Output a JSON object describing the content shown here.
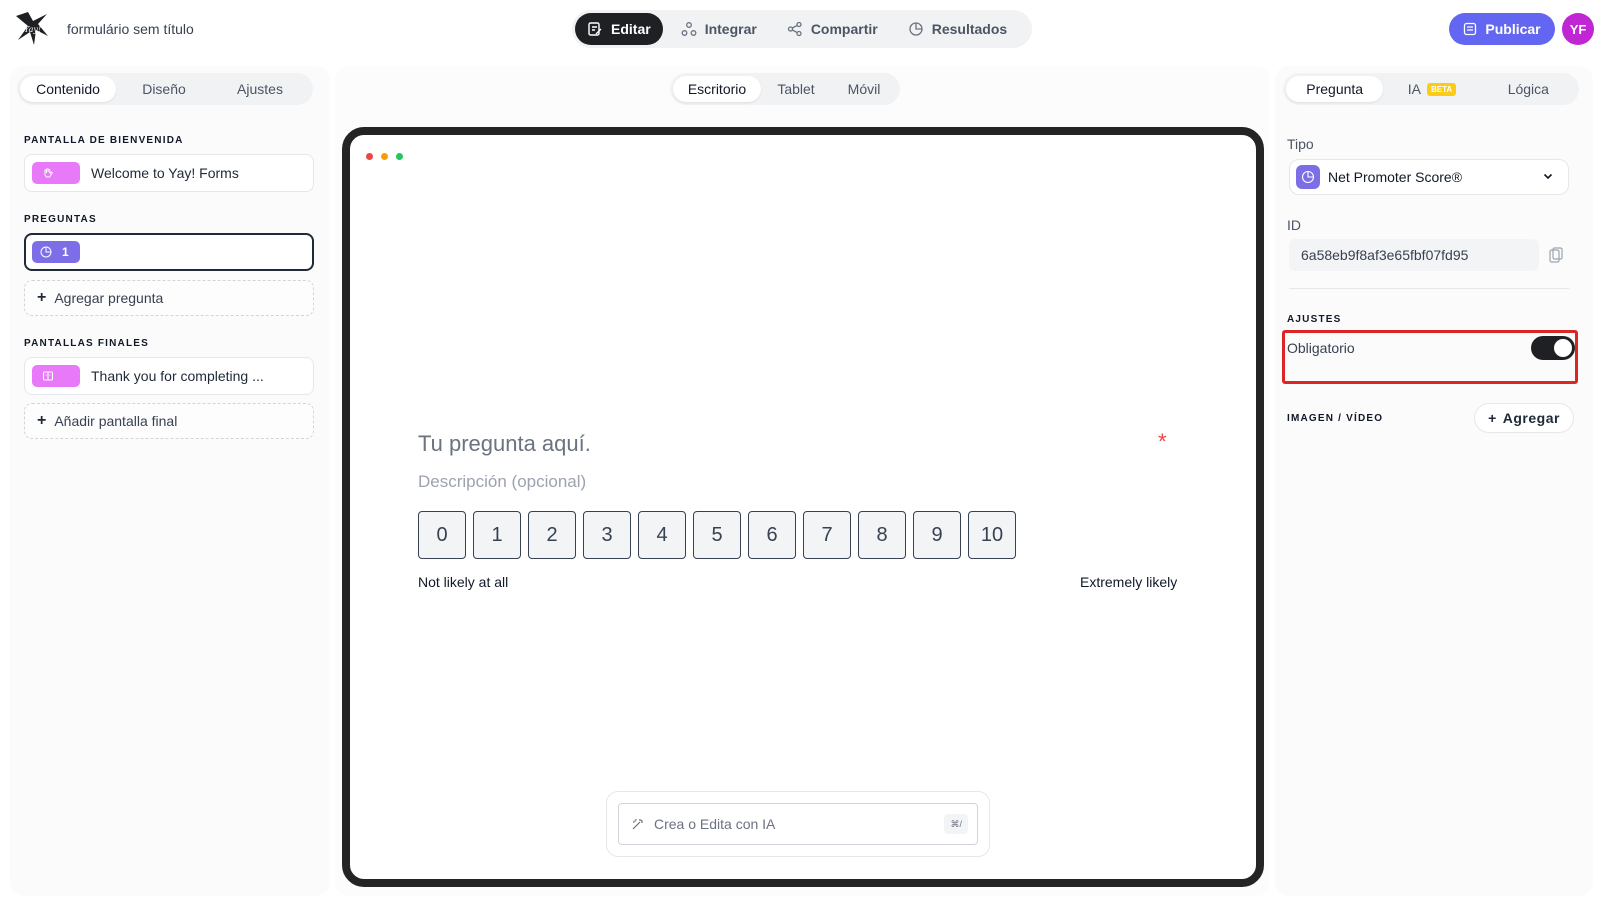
{
  "header": {
    "logo_text": "Yay!",
    "form_title": "formulário sem título",
    "modes": [
      {
        "label": "Editar",
        "icon": "edit-icon",
        "active": true
      },
      {
        "label": "Integrar",
        "icon": "integrate-icon",
        "active": false
      },
      {
        "label": "Compartir",
        "icon": "share-icon",
        "active": false
      },
      {
        "label": "Resultados",
        "icon": "results-icon",
        "active": false
      }
    ],
    "publish_label": "Publicar",
    "avatar_initials": "YF"
  },
  "left": {
    "tabs": [
      "Contenido",
      "Diseño",
      "Ajustes"
    ],
    "welcome_section": "PANTALLA DE BIENVENIDA",
    "welcome_item": "Welcome to Yay! Forms",
    "questions_section": "PREGUNTAS",
    "question_number": "1",
    "add_question": "Agregar pregunta",
    "end_section": "PANTALLAS FINALES",
    "end_item": "Thank you for completing ...",
    "add_end": "Añadir pantalla final"
  },
  "center": {
    "device_tabs": [
      "Escritorio",
      "Tablet",
      "Móvil"
    ],
    "question_title": "Tu pregunta aquí.",
    "required_mark": "*",
    "description": "Descripción (opcional)",
    "scale": [
      "0",
      "1",
      "2",
      "3",
      "4",
      "5",
      "6",
      "7",
      "8",
      "9",
      "10"
    ],
    "low_label": "Not likely at all",
    "high_label": "Extremely likely",
    "ai_placeholder": "Crea o Edita con IA",
    "ai_shortcut": "⌘/"
  },
  "right": {
    "tabs": [
      "Pregunta",
      "IA",
      "Lógica"
    ],
    "beta_badge": "BETA",
    "type_label": "Tipo",
    "type_value": "Net Promoter Score®",
    "id_label": "ID",
    "id_value": "6a58eb9f8af3e65fbf07fd95",
    "settings_section": "AJUSTES",
    "required_label": "Obligatorio",
    "required_on": true,
    "media_section": "IMAGEN / VÍDEO",
    "add_media": "Agregar"
  },
  "colors": {
    "accent": "#6366f1",
    "avatar": "#c026d3",
    "welcome_chip": "#e879f9",
    "question_chip": "#7c6ee6",
    "highlight": "#dc2626"
  }
}
